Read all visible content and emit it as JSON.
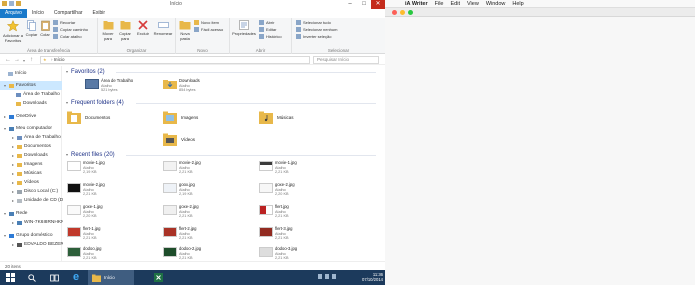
{
  "explorer": {
    "window_title": "Início",
    "ribbon_tabs": [
      "Arquivo",
      "Início",
      "Compartilhar",
      "Exibir"
    ],
    "ribbon": {
      "clipboard": {
        "pin_label": "Adicionar a Favoritos",
        "copy_label": "Copiar",
        "paste_label": "Colar",
        "cut_label": "Recortar",
        "copy_path_label": "Copiar caminho",
        "paste_shortcut_label": "Colar atalho",
        "group_label": "Área de transferência"
      },
      "organize": {
        "move_label": "Mover para",
        "copy_to_label": "Copiar para",
        "delete_label": "Excluir",
        "rename_label": "Renomear",
        "group_label": "Organizar"
      },
      "new": {
        "new_folder_label": "Nova pasta",
        "new_item_label": "Novo item",
        "easy_access_label": "Fácil acesso",
        "group_label": "Novo"
      },
      "open": {
        "properties_label": "Propriedades",
        "open_label": "Abrir",
        "edit_label": "Editar",
        "history_label": "Histórico",
        "group_label": "Abrir"
      },
      "select": {
        "select_all_label": "Selecionar tudo",
        "select_none_label": "Selecionar nenhum",
        "invert_label": "Inverter seleção",
        "group_label": "Selecionar"
      }
    },
    "address": {
      "path": "Início",
      "search_placeholder": "Pesquisar Início"
    },
    "nav": {
      "items": [
        {
          "label": "Início"
        },
        {
          "label": "Favoritos"
        },
        {
          "label": "Área de Trabalho"
        },
        {
          "label": "Downloads"
        },
        {
          "label": "OneDrive"
        },
        {
          "label": "Meu computador"
        },
        {
          "label": "Área de Trabalho"
        },
        {
          "label": "Documentos"
        },
        {
          "label": "Downloads"
        },
        {
          "label": "Imagens"
        },
        {
          "label": "Músicas"
        },
        {
          "label": "Vídeos"
        },
        {
          "label": "Disco Local (C:)"
        },
        {
          "label": "Unidade de CD (D:)"
        },
        {
          "label": "Rede"
        },
        {
          "label": "WIN-7K6I8RNHKN"
        },
        {
          "label": "Grupo doméstico"
        },
        {
          "label": "EDVALDO BEZER"
        }
      ]
    },
    "favorites": {
      "heading": "Favoritos (2)",
      "items": [
        {
          "name": "Área de Trabalho",
          "sub": "Atalho",
          "size": "521 bytes"
        },
        {
          "name": "Downloads",
          "sub": "Atalho",
          "size": "854 bytes"
        }
      ]
    },
    "frequent": {
      "heading": "Frequent folders (4)",
      "items": [
        {
          "name": "Documentos"
        },
        {
          "name": "Imagens"
        },
        {
          "name": "Músicas"
        },
        {
          "name": "Vídeos"
        }
      ]
    },
    "recent": {
      "heading": "Recent files (20)",
      "items": [
        {
          "name": "movie-1.jpg",
          "sub": "Atalho",
          "size": "2,19 KB"
        },
        {
          "name": "movie-2.jpg",
          "sub": "Atalho",
          "size": "2,21 KB"
        },
        {
          "name": "movie-1.jpg",
          "sub": "Atalho",
          "size": "2,21 KB"
        },
        {
          "name": "movie-2.jpg",
          "sub": "Atalho",
          "size": "2,21 KB"
        },
        {
          "name": "goox.jpg",
          "sub": "Atalho",
          "size": "2,19 KB"
        },
        {
          "name": "goxe-2.jpg",
          "sub": "Atalho",
          "size": "2,20 KB"
        },
        {
          "name": "goxe-1.jpg",
          "sub": "Atalho",
          "size": "2,20 KB"
        },
        {
          "name": "goxe-2.jpg",
          "sub": "Atalho",
          "size": "2,21 KB"
        },
        {
          "name": "flert.jpg",
          "sub": "Atalho",
          "size": "2,21 KB"
        },
        {
          "name": "flert-1.jpg",
          "sub": "Atalho",
          "size": "2,21 KB"
        },
        {
          "name": "flert-2.jpg",
          "sub": "Atalho",
          "size": "2,21 KB"
        },
        {
          "name": "flert-3.jpg",
          "sub": "Atalho",
          "size": "2,21 KB"
        },
        {
          "name": "dodoo.jpg",
          "sub": "Atalho",
          "size": "2,21 KB"
        },
        {
          "name": "dodoo-2.jpg",
          "sub": "Atalho",
          "size": "2,21 KB"
        },
        {
          "name": "dodoo-3.jpg",
          "sub": "Atalho",
          "size": "2,21 KB"
        }
      ]
    },
    "status": "20 itens",
    "taskbar": {
      "active_app_label": "Início",
      "time": "11:36",
      "date": "07/10/2014"
    }
  },
  "mac": {
    "apple_symbol": "",
    "menus": [
      "iA Writer",
      "File",
      "Edit",
      "View",
      "Window",
      "Help"
    ]
  },
  "colors": {
    "file_tab": "#1979ca",
    "selection": "#cce8ff",
    "taskbar": "#1c3a5c",
    "section_heading": "#1e3287",
    "folder": "#e8b84a",
    "close_red": "#fc5f57",
    "minimize_yellow": "#fdbc2e",
    "zoom_green": "#28c840"
  }
}
